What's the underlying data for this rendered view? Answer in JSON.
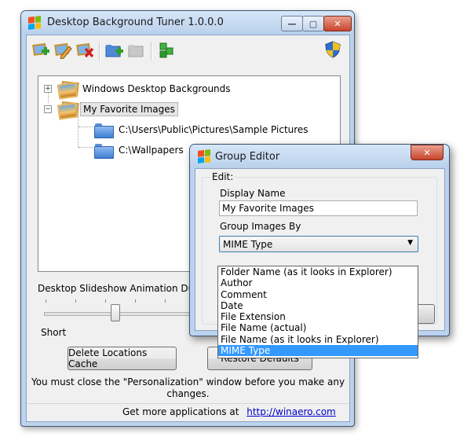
{
  "main_window": {
    "title": "Desktop Background Tuner 1.0.0.0",
    "controls": {
      "minimize": "—",
      "maximize": "▢",
      "close": "✕"
    }
  },
  "toolbar": {
    "icons": [
      "add-picture-icon",
      "edit-picture-icon",
      "delete-picture-icon",
      "add-folder-icon",
      "remove-folder-icon",
      "export-icon",
      "shield-icon"
    ]
  },
  "tree": {
    "items": [
      {
        "label": "Windows Desktop Backgrounds",
        "expander": "+"
      },
      {
        "label": "My Favorite Images",
        "expander": "−"
      },
      {
        "label": "C:\\Users\\Public\\Pictures\\Sample Pictures"
      },
      {
        "label": "C:\\Wallpapers"
      }
    ]
  },
  "slideshow": {
    "label": "Desktop Slideshow Animation Duratio",
    "min_label": "Short",
    "position": 0.48
  },
  "buttons": {
    "delete_cache": "Delete Locations Cache",
    "restore_defaults": "Restore Defaults"
  },
  "note": {
    "line1": "You must close the \"Personalization\" window before you make any",
    "line2": "changes."
  },
  "footer": {
    "text": "Get more applications at",
    "link": "http://winaero.com"
  },
  "group_editor": {
    "title": "Group Editor",
    "close": "✕",
    "group_label": "Edit:",
    "display_name_label": "Display Name",
    "display_name_value": "My Favorite Images",
    "group_by_label": "Group Images By",
    "group_by_value": "MIME Type",
    "options": [
      "Folder Name (as it looks in Explorer)",
      "Author",
      "Comment",
      "Date",
      "File Extension",
      "File Name (actual)",
      "File Name (as it looks in Explorer)",
      "MIME Type"
    ],
    "selected_index": 7
  }
}
